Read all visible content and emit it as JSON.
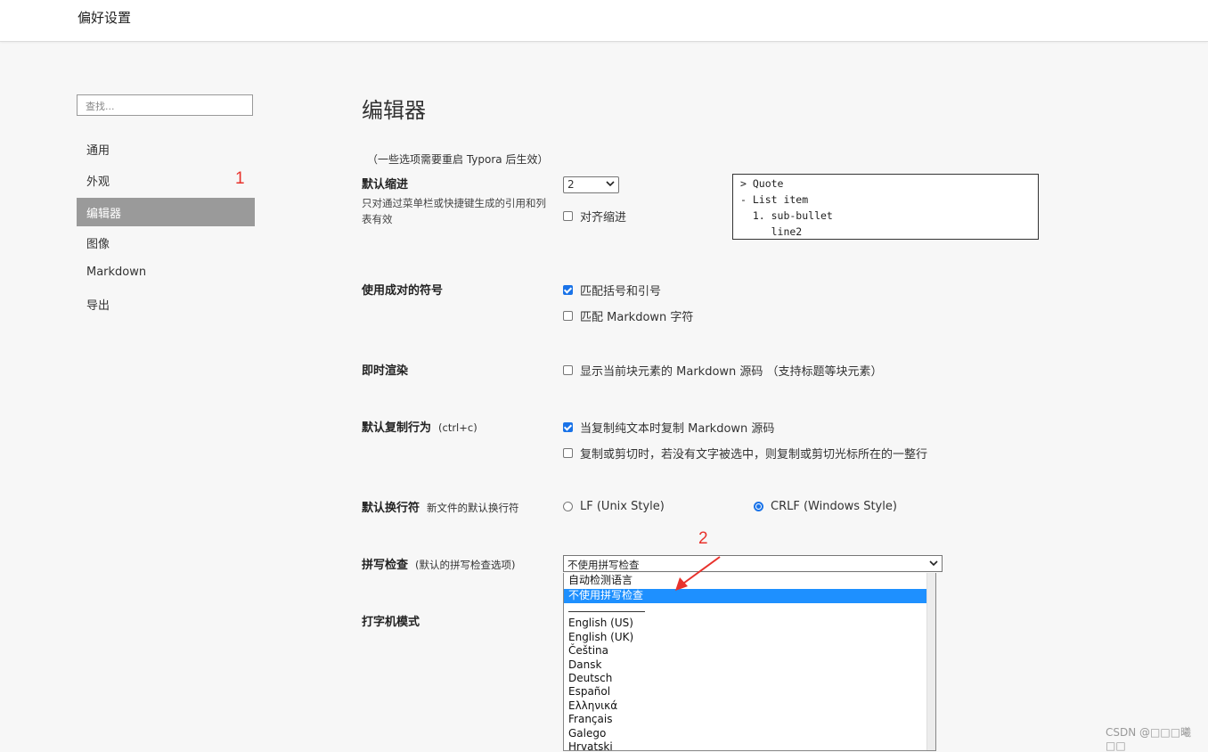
{
  "window": {
    "title": "偏好设置"
  },
  "sidebar": {
    "search_placeholder": "查找...",
    "items": [
      {
        "label": "通用"
      },
      {
        "label": "外观"
      },
      {
        "label": "编辑器",
        "active": true
      },
      {
        "label": "图像"
      },
      {
        "label": "Markdown"
      },
      {
        "label": "导出"
      }
    ]
  },
  "annotations": {
    "marker1": "1",
    "marker2": "2"
  },
  "main": {
    "heading": "编辑器",
    "restart_note": "（一些选项需要重启 Typora 后生效）",
    "indent": {
      "label": "默认缩进",
      "description": "只对通过菜单栏或快捷键生成的引用和列表有效",
      "value": "2",
      "align_label": "对齐缩进",
      "align_checked": false,
      "preview": [
        "> Quote",
        "- List item",
        "  1. sub-bullet",
        "     line2"
      ]
    },
    "pairs": {
      "label": "使用成对的符号",
      "match_brackets": "匹配括号和引号",
      "match_brackets_checked": true,
      "match_markdown": "匹配 Markdown 字符",
      "match_markdown_checked": false
    },
    "live_render": {
      "label": "即时渲染",
      "show_source": "显示当前块元素的 Markdown 源码 （支持标题等块元素）",
      "show_source_checked": false
    },
    "copy": {
      "label": "默认复制行为",
      "sub": "(ctrl+c)",
      "copy_markdown": "当复制纯文本时复制 Markdown 源码",
      "copy_markdown_checked": true,
      "copy_line": "复制或剪切时，若没有文字被选中，则复制或剪切光标所在的一整行",
      "copy_line_checked": false
    },
    "line_ending": {
      "label": "默认换行符",
      "sub": "新文件的默认换行符",
      "lf": "LF (Unix Style)",
      "crlf": "CRLF (Windows Style)",
      "selected": "crlf"
    },
    "spell": {
      "label": "拼写检查",
      "sub": "(默认的拼写检查选项)",
      "value": "不使用拼写检查",
      "options": [
        "自动检测语言",
        "不使用拼写检查",
        "English (US)",
        "English (UK)",
        "Čeština",
        "Dansk",
        "Deutsch",
        "Español",
        "Ελληνικά",
        "Français",
        "Galego",
        "Hrvatski"
      ],
      "highlighted": "不使用拼写检查"
    },
    "typewriter": {
      "label": "打字机模式"
    }
  },
  "watermark": "CSDN @□□□曦□□",
  "colors": {
    "accent": "#1a73e8",
    "highlight": "#1e90ff",
    "annotation": "#e8322c",
    "active_nav": "#9a9a9a"
  }
}
